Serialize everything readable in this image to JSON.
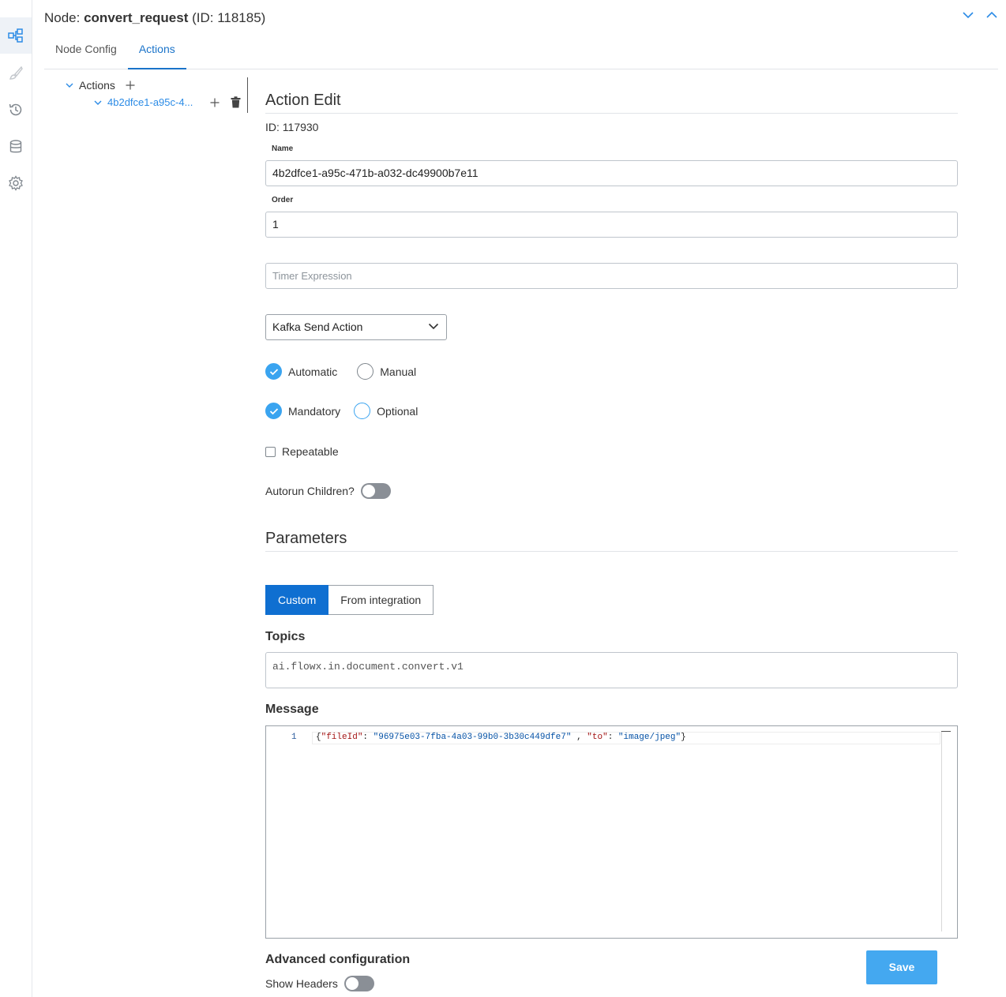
{
  "header": {
    "prefix": "Node: ",
    "node_name": "convert_request",
    "id_text": " (ID: 118185)"
  },
  "tabs": [
    {
      "label": "Node Config",
      "active": false
    },
    {
      "label": "Actions",
      "active": true
    }
  ],
  "tree": {
    "root_label": "Actions",
    "child_label": "4b2dfce1-a95c-4..."
  },
  "action_edit": {
    "title": "Action Edit",
    "id_text": "ID: 117930",
    "name_label": "Name",
    "name_value": "4b2dfce1-a95c-471b-a032-dc49900b7e11",
    "order_label": "Order",
    "order_value": "1",
    "timer_placeholder": "Timer Expression",
    "action_type": "Kafka Send Action",
    "trigger_options": [
      {
        "label": "Automatic",
        "checked": true
      },
      {
        "label": "Manual",
        "checked": false
      }
    ],
    "required_options": [
      {
        "label": "Mandatory",
        "checked": true
      },
      {
        "label": "Optional",
        "checked": false
      }
    ],
    "repeatable_label": "Repeatable",
    "repeatable_checked": false,
    "autorun_label": "Autorun Children?",
    "autorun_on": false
  },
  "parameters": {
    "title": "Parameters",
    "seg_custom": "Custom",
    "seg_integration": "From integration",
    "topics_label": "Topics",
    "topics_value": "ai.flowx.in.document.convert.v1",
    "message_label": "Message",
    "message": {
      "line_number": "1",
      "open": "{",
      "k1": "\"fileId\"",
      "sep1": ": ",
      "v1": "\"96975e03-7fba-4a03-99b0-3b30c449dfe7\"",
      "comma": " , ",
      "k2": "\"to\"",
      "sep2": ": ",
      "v2": "\"image/jpeg\"",
      "close": "}"
    }
  },
  "advanced": {
    "title": "Advanced configuration",
    "show_headers_label": "Show Headers",
    "show_headers_on": false
  },
  "save_label": "Save",
  "colors": {
    "accent": "#1a73c9",
    "primary_button": "#44a8f0",
    "segment_active": "#0f6fd1",
    "radio_checked": "#3aa4f0"
  }
}
